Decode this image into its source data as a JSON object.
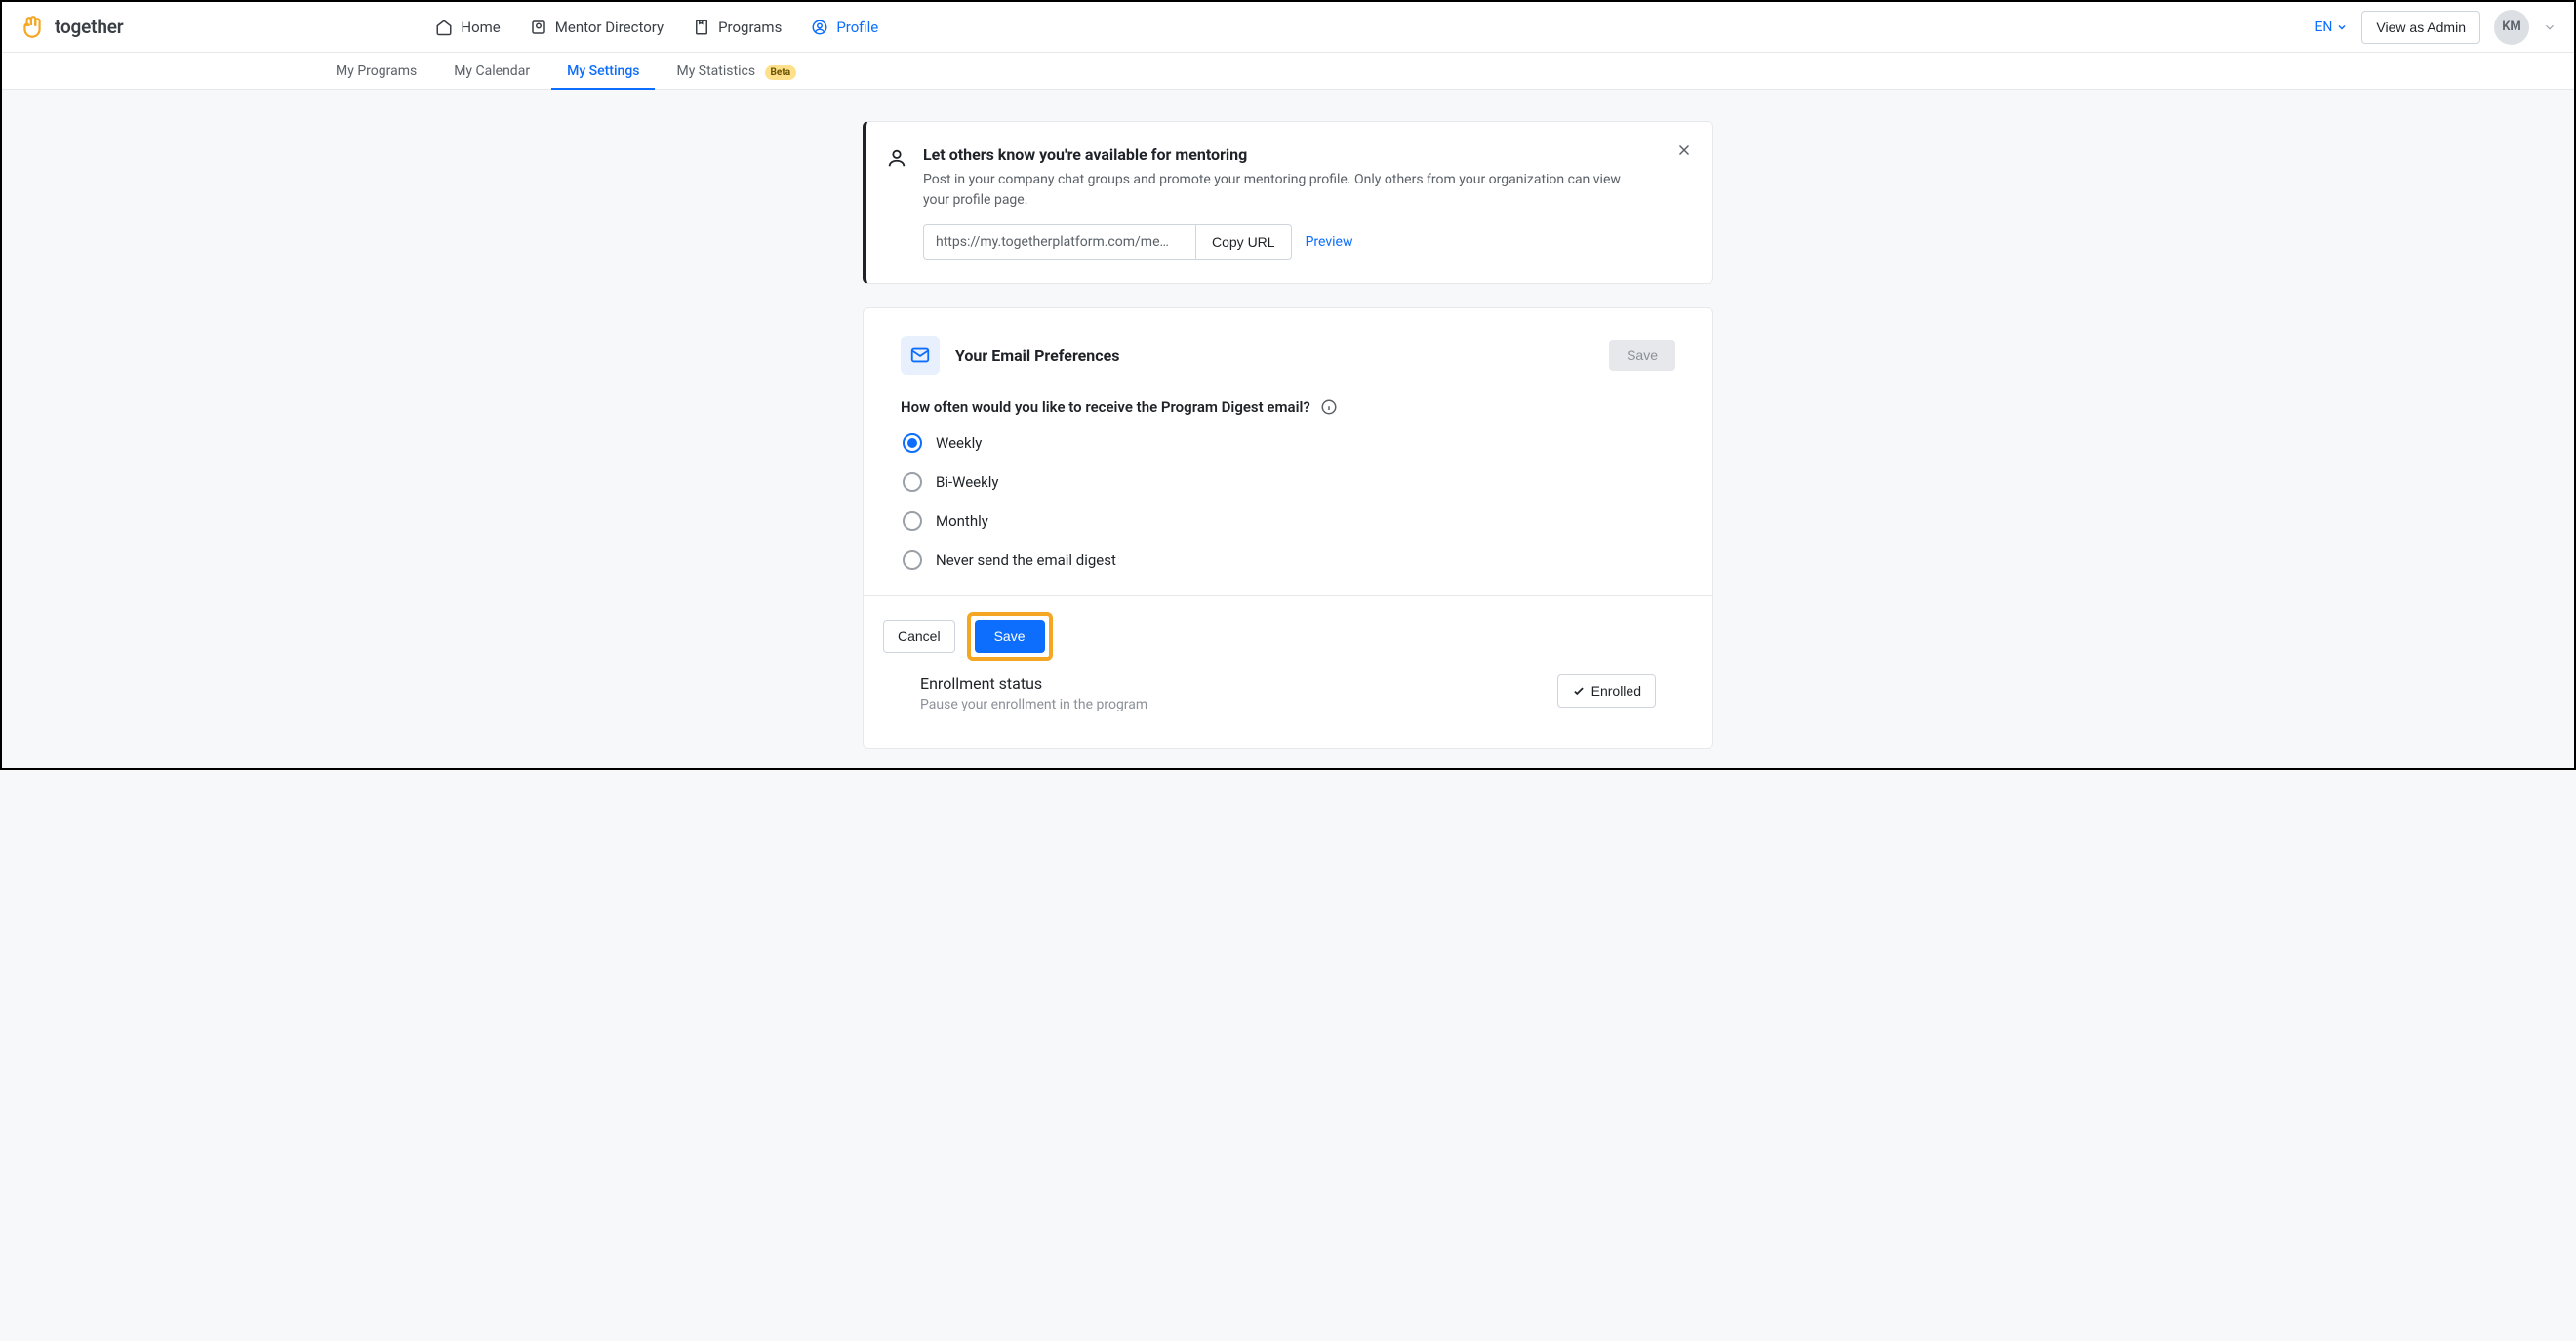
{
  "brand": "together",
  "nav": {
    "home": "Home",
    "mentor_directory": "Mentor Directory",
    "programs": "Programs",
    "profile": "Profile"
  },
  "topbar": {
    "lang": "EN",
    "view_as_admin": "View as Admin",
    "avatar_initials": "KM"
  },
  "subnav": {
    "my_programs": "My Programs",
    "my_calendar": "My Calendar",
    "my_settings": "My Settings",
    "my_statistics": "My Statistics",
    "beta": "Beta"
  },
  "banner": {
    "title": "Let others know you're available for mentoring",
    "desc": "Post in your company chat groups and promote your mentoring profile. Only others from your organization can view your profile page.",
    "url": "https://my.togetherplatform.com/me…",
    "copy": "Copy URL",
    "preview": "Preview"
  },
  "prefs": {
    "title": "Your Email Preferences",
    "save_disabled": "Save",
    "question": "How often would you like to receive the Program Digest email?",
    "options": [
      "Weekly",
      "Bi-Weekly",
      "Monthly",
      "Never send the email digest"
    ],
    "selected_index": 0,
    "cancel": "Cancel",
    "save": "Save"
  },
  "enroll": {
    "title": "Enrollment status",
    "desc": "Pause your enrollment in the program",
    "button": "Enrolled"
  }
}
